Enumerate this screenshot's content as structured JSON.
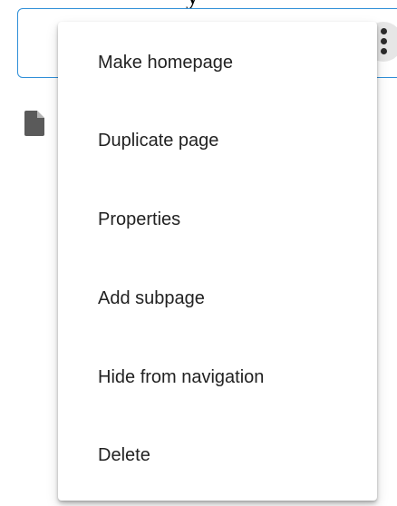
{
  "menu": {
    "items": [
      {
        "label": "Make homepage"
      },
      {
        "label": "Duplicate page"
      },
      {
        "label": "Properties"
      },
      {
        "label": "Add subpage"
      },
      {
        "label": "Hide from navigation"
      },
      {
        "label": "Delete"
      }
    ]
  },
  "colors": {
    "card_border": "#2f8fd8",
    "menu_text": "#222222",
    "more_button_bg": "#e6e6e6"
  },
  "icons": {
    "more": "vertical-dots-icon",
    "page": "page-document-icon"
  }
}
